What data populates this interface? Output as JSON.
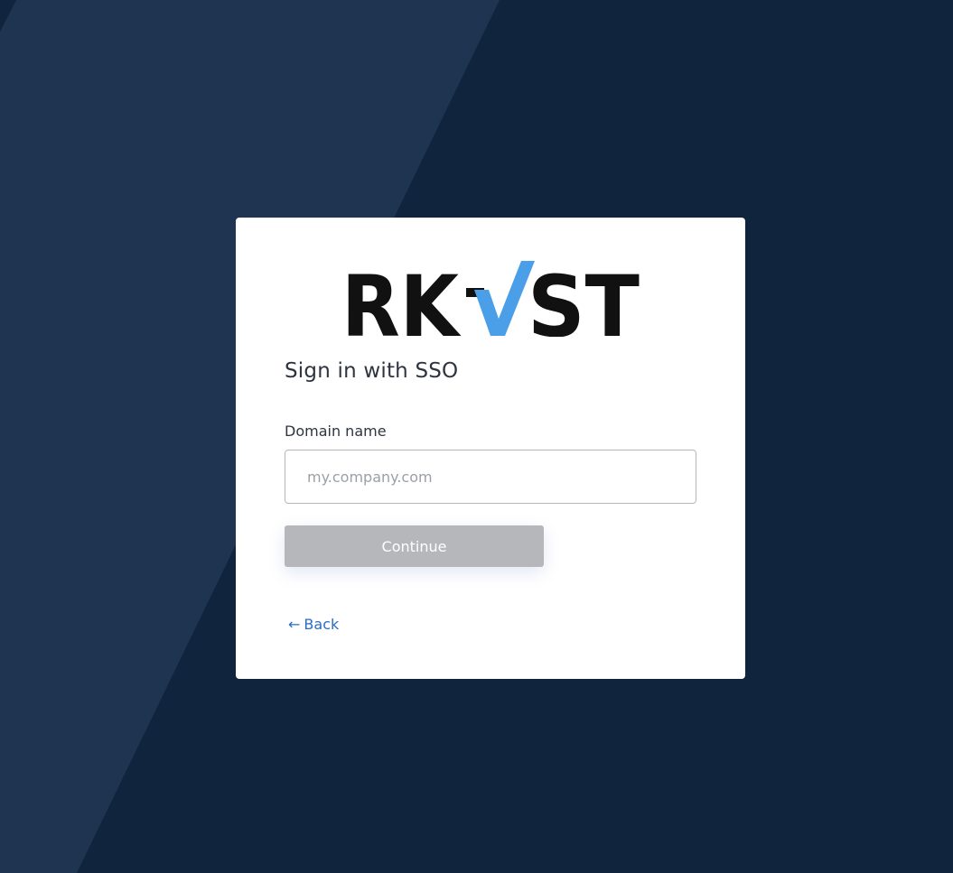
{
  "background": {
    "base_color": "#10243d",
    "stripe_color": "#1f3450"
  },
  "logo": {
    "text_left": "RK",
    "text_right": "ST",
    "text_color": "#111111",
    "check_color": "#4a9fe8"
  },
  "signin": {
    "title": "Sign in with SSO",
    "domain_label": "Domain name",
    "domain_placeholder": "my.company.com",
    "domain_value": "",
    "continue_label": "Continue",
    "back_arrow": "←",
    "back_label": "Back",
    "link_color": "#2b6cc4"
  }
}
